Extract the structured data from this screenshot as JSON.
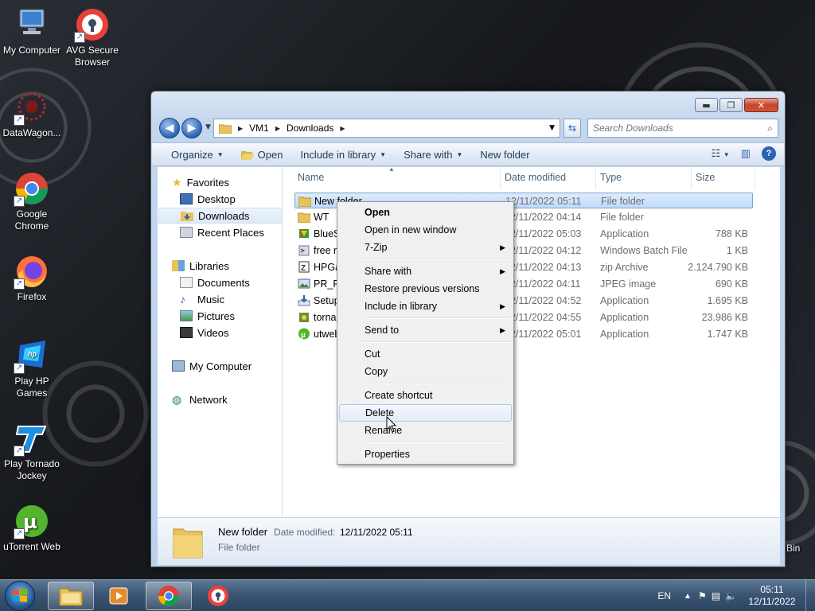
{
  "desktop": {
    "icons": [
      {
        "label": "My Computer"
      },
      {
        "label": "AVG Secure Browser"
      },
      {
        "label": "DataWagon..."
      },
      {
        "label": "Google Chrome"
      },
      {
        "label": "Firefox"
      },
      {
        "label": "Play HP Games"
      },
      {
        "label": "Play Tornado Jockey"
      },
      {
        "label": "uTorrent Web"
      }
    ],
    "recycle_bin_partial": "Bin"
  },
  "window": {
    "caption_buttons": {
      "minimize": "▬",
      "maximize": "❐",
      "close": "✕"
    },
    "address": {
      "crumbs": [
        "VM1",
        "Downloads"
      ],
      "search_placeholder": "Search Downloads"
    },
    "commands": {
      "organize": "Organize",
      "open": "Open",
      "include_in_library": "Include in library",
      "share_with": "Share with",
      "new_folder": "New folder"
    },
    "nav_pane": {
      "favorites": "Favorites",
      "desktop": "Desktop",
      "downloads": "Downloads",
      "recent_places": "Recent Places",
      "libraries": "Libraries",
      "documents": "Documents",
      "music": "Music",
      "pictures": "Pictures",
      "videos": "Videos",
      "my_computer": "My Computer",
      "network": "Network"
    },
    "columns": {
      "name": "Name",
      "date_modified": "Date modified",
      "type": "Type",
      "size": "Size"
    },
    "files": [
      {
        "name": "New folder",
        "date": "12/11/2022 05:11",
        "type": "File folder",
        "size": ""
      },
      {
        "name": "WT",
        "date": "12/11/2022 04:14",
        "type": "File folder",
        "size": ""
      },
      {
        "name": "BlueS",
        "date": "12/11/2022 05:03",
        "type": "Application",
        "size": "788 KB"
      },
      {
        "name": "free r",
        "date": "12/11/2022 04:12",
        "type": "Windows Batch File",
        "size": "1 KB"
      },
      {
        "name": "HPGa",
        "date": "12/11/2022 04:13",
        "type": "zip Archive",
        "size": "2.124.790 KB"
      },
      {
        "name": "PR_Ri",
        "date": "12/11/2022 04:11",
        "type": "JPEG image",
        "size": "690 KB"
      },
      {
        "name": "Setup",
        "date": "12/11/2022 04:52",
        "type": "Application",
        "size": "1.695 KB"
      },
      {
        "name": "torna",
        "date": "12/11/2022 04:55",
        "type": "Application",
        "size": "23.986 KB"
      },
      {
        "name": "utweb",
        "date": "12/11/2022 05:01",
        "type": "Application",
        "size": "1.747 KB"
      }
    ],
    "details": {
      "name": "New folder",
      "date_label": "Date modified:",
      "date_value": "12/11/2022 05:11",
      "type": "File folder"
    }
  },
  "context_menu": {
    "open": "Open",
    "open_new_window": "Open in new window",
    "seven_zip": "7-Zip",
    "share_with": "Share with",
    "restore_previous": "Restore previous versions",
    "include_in_library": "Include in library",
    "send_to": "Send to",
    "cut": "Cut",
    "copy": "Copy",
    "create_shortcut": "Create shortcut",
    "delete": "Delete",
    "rename": "Rename",
    "properties": "Properties"
  },
  "taskbar": {
    "language": "EN",
    "time": "05:11",
    "date": "12/11/2022"
  }
}
